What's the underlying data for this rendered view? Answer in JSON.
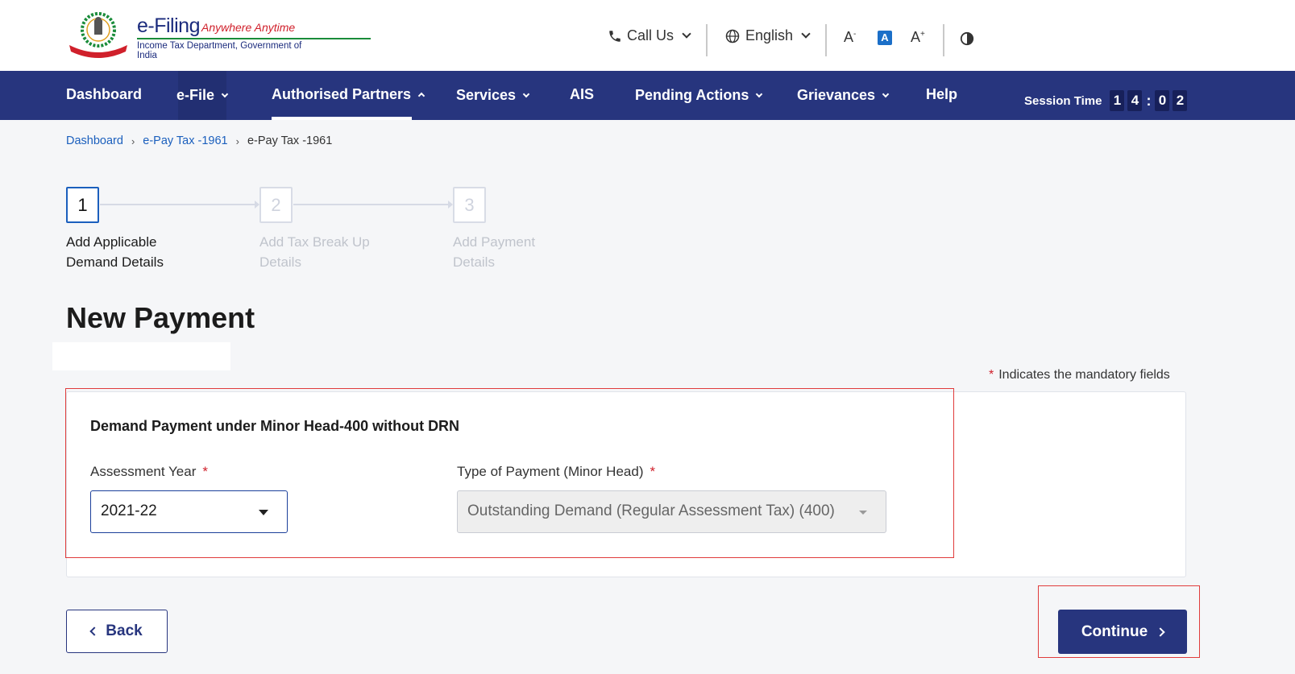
{
  "header": {
    "logo_title": "e-Filing",
    "logo_tagline": "Anywhere Anytime",
    "logo_subtitle": "Income Tax Department, Government of India",
    "call_us": "Call Us",
    "language": "English",
    "font_decrease": "A",
    "font_default": "A",
    "font_increase": "A",
    "colors": {
      "primary": "#27357e",
      "accent_red": "#d0202b",
      "link": "#1b5fbd"
    }
  },
  "nav": {
    "items": [
      {
        "label": "Dashboard"
      },
      {
        "label": "e-File"
      },
      {
        "label": "Authorised Partners"
      },
      {
        "label": "Services"
      },
      {
        "label": "AIS"
      },
      {
        "label": "Pending Actions"
      },
      {
        "label": "Grievances"
      },
      {
        "label": "Help"
      }
    ],
    "session_label": "Session Time",
    "session_digits": [
      "1",
      "4",
      "0",
      "2"
    ]
  },
  "breadcrumb": {
    "items": [
      "Dashboard",
      "e-Pay Tax -1961",
      "e-Pay Tax -1961"
    ]
  },
  "stepper": {
    "steps": [
      {
        "number": "1",
        "line1": "Add Applicable",
        "line2": "Demand Details",
        "active": true
      },
      {
        "number": "2",
        "line1": "Add Tax Break Up",
        "line2": "Details",
        "active": false
      },
      {
        "number": "3",
        "line1": "Add Payment",
        "line2": "Details",
        "active": false
      }
    ]
  },
  "main": {
    "title": "New Payment",
    "mandatory_star": "*",
    "mandatory_note": "Indicates the mandatory fields",
    "card_heading": "Demand Payment under Minor Head-400 without DRN",
    "assessment_year": {
      "label": "Assessment Year",
      "required": "*",
      "value": "2021-22"
    },
    "payment_type": {
      "label": "Type of Payment (Minor Head)",
      "required": "*",
      "value": "Outstanding Demand (Regular Assessment Tax) (400)"
    }
  },
  "buttons": {
    "back": "Back",
    "continue": "Continue"
  }
}
